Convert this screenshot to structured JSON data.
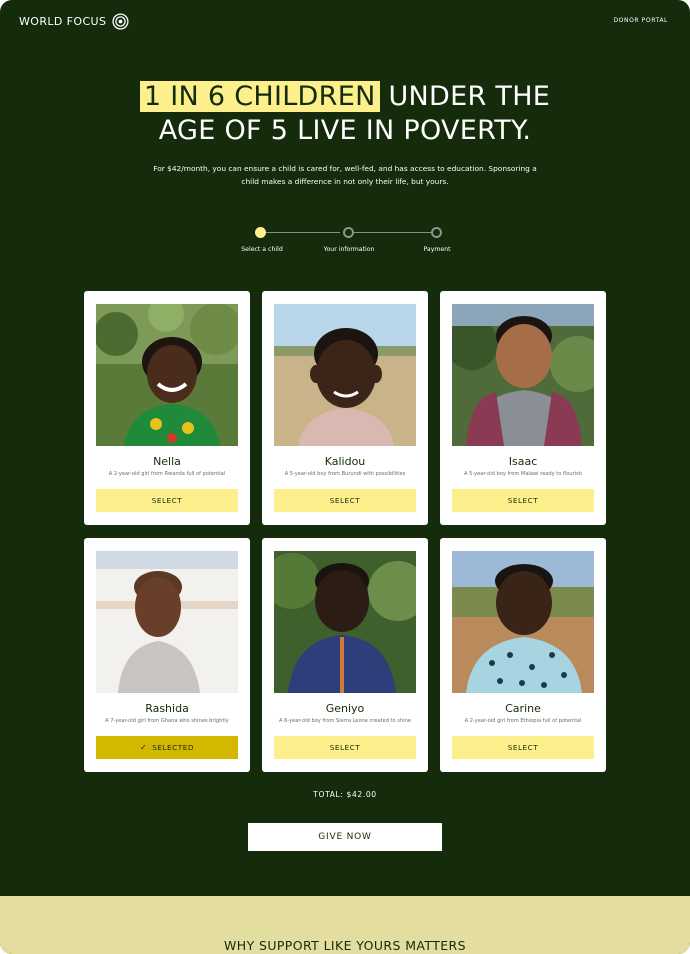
{
  "brand": {
    "name": "WORLD FOCUS",
    "icon": "concentric-target-icon"
  },
  "header": {
    "portal_label": "DONOR PORTAL"
  },
  "hero": {
    "headline_highlight": "1 IN 6 CHILDREN",
    "headline_line1_rest": " UNDER THE",
    "headline_line2": "AGE OF 5 LIVE IN POVERTY.",
    "subcopy": "For $42/month, you can ensure a child is cared for, well-fed, and has access to education. Sponsoring a child makes a difference in not only their life, but yours."
  },
  "stepper": {
    "steps": [
      {
        "label": "Select a child",
        "state": "active"
      },
      {
        "label": "Your information",
        "state": "inactive"
      },
      {
        "label": "Payment",
        "state": "inactive"
      }
    ]
  },
  "children": [
    {
      "name": "Nella",
      "description": "A 2-year-old girl from Rwanda full of potential",
      "button": "SELECT",
      "selected": false
    },
    {
      "name": "Kalidou",
      "description": "A 5-year-old boy from Burundi with possibilities",
      "button": "SELECT",
      "selected": false
    },
    {
      "name": "Isaac",
      "description": "A 5-year-old boy from Malawi ready to flourish",
      "button": "SELECT",
      "selected": false
    },
    {
      "name": "Rashida",
      "description": "A 7-year-old girl from Ghana who shines brightly",
      "button": "SELECTED",
      "selected": true
    },
    {
      "name": "Geniyo",
      "description": "A 6-year-old boy from Sierra Leone created to shine",
      "button": "SELECT",
      "selected": false
    },
    {
      "name": "Carine",
      "description": "A 2-year-old girl from Ethiopia full of potential",
      "button": "SELECT",
      "selected": false
    }
  ],
  "summary": {
    "total": "TOTAL: $42.00",
    "cta": "GIVE NOW"
  },
  "next_section": {
    "title": "WHY SUPPORT LIKE YOURS MATTERS"
  },
  "colors": {
    "background": "#142b0c",
    "accent": "#fdf08c",
    "selected": "#d2b900",
    "band": "#e3dea0"
  }
}
